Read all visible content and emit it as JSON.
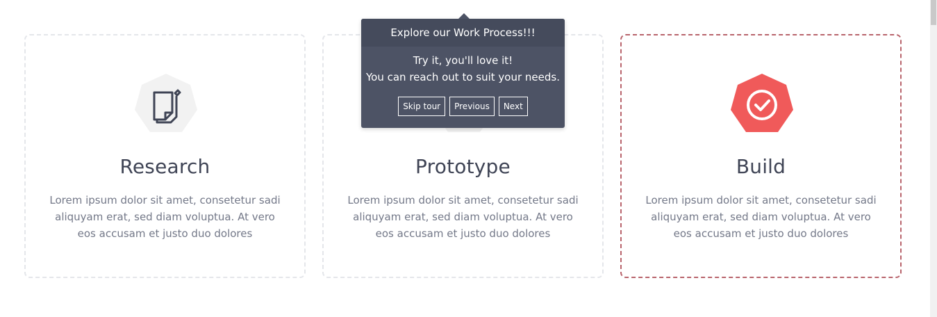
{
  "cards": [
    {
      "title": "Research",
      "text": "Lorem ipsum dolor sit amet, consetetur sadi aliquyam erat, sed diam voluptua. At vero eos accusam et justo duo dolores",
      "icon": "note-icon"
    },
    {
      "title": "Prototype",
      "text": "Lorem ipsum dolor sit amet, consetetur sadi aliquyam erat, sed diam voluptua. At vero eos accusam et justo duo dolores",
      "icon": "prototype-icon"
    },
    {
      "title": "Build",
      "text": "Lorem ipsum dolor sit amet, consetetur sadi aliquyam erat, sed diam voluptua. At vero eos accusam et justo duo dolores",
      "icon": "check-circle-icon"
    }
  ],
  "tooltip": {
    "title": "Explore our Work Process!!!",
    "line1": "Try it, you'll love it!",
    "line2": "You can reach out to suit your needs.",
    "skip_label": "Skip tour",
    "previous_label": "Previous",
    "next_label": "Next"
  },
  "colors": {
    "accent": "#f05a5a",
    "tooltip_bg": "#4d5365",
    "active_border": "#b8636b",
    "icon_bg": "#f2f2f2"
  }
}
